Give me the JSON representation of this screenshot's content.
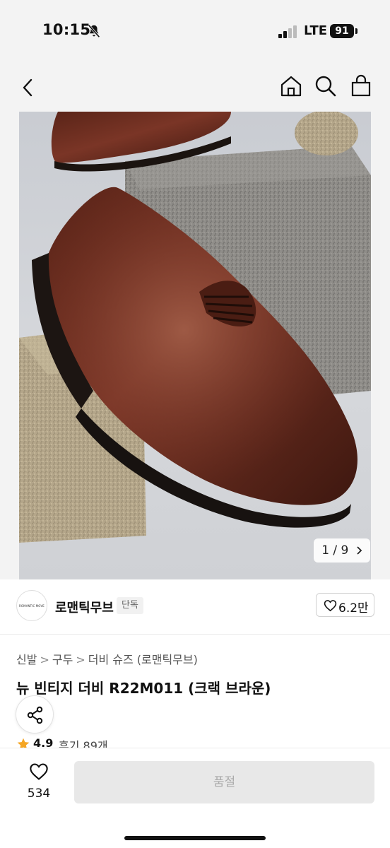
{
  "status_bar": {
    "time": "10:15",
    "network": "LTE",
    "battery": "91",
    "icons": [
      "bell-slash-icon",
      "signal-icon"
    ]
  },
  "nav": {
    "icons": [
      "back-chevron-icon",
      "home-icon",
      "search-icon",
      "shopping-bag-icon"
    ]
  },
  "gallery": {
    "counter": "1 / 9",
    "counter_icon": "chevron-right-icon",
    "image_description_icon": "product-photo"
  },
  "brand": {
    "logo_text": "ROMANTIC MOVE",
    "name": "로맨틱무브",
    "badge": "단독",
    "likes": "6.2만",
    "like_icon": "heart-outline-icon"
  },
  "breadcrumb": {
    "items": [
      "신발",
      "구두",
      "더비 슈즈 (로맨틱무브)"
    ],
    "separator": ">"
  },
  "product": {
    "title": "뉴 빈티지 더비 R22M011 (크랙 브라운)",
    "rating": "4.9",
    "reviews": "후기 89개",
    "star_color": "#f5a623"
  },
  "bottom_bar": {
    "wish_count": "534",
    "soldout_label": "품절"
  },
  "colors": {
    "background": "#ffffff",
    "header_bg": "#f3f3f3",
    "disabled_button": "#e8e8e8",
    "disabled_text": "#aaaaaa"
  }
}
